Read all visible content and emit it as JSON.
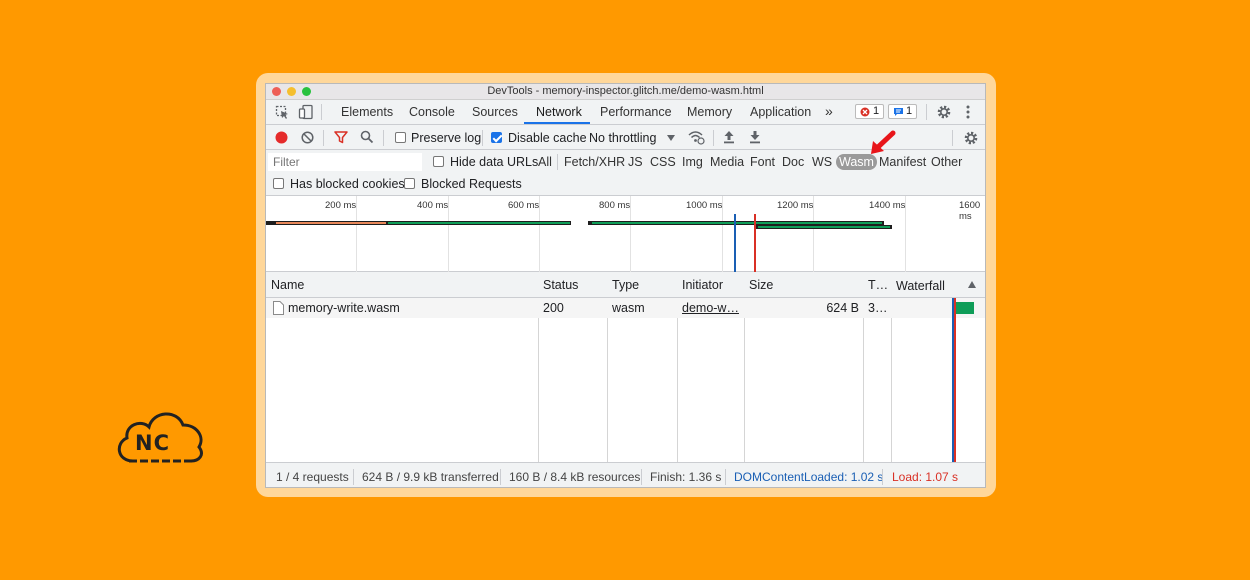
{
  "window": {
    "title": "DevTools - memory-inspector.glitch.me/demo-wasm.html"
  },
  "tabs": [
    {
      "label": "Elements"
    },
    {
      "label": "Console"
    },
    {
      "label": "Sources"
    },
    {
      "label": "Network",
      "active": true
    },
    {
      "label": "Performance"
    },
    {
      "label": "Memory"
    },
    {
      "label": "Application"
    }
  ],
  "more_tabs": "»",
  "badges": {
    "errors": "1",
    "messages": "1"
  },
  "toolbar": {
    "preserve_log": "Preserve log",
    "disable_cache": "Disable cache",
    "throttling": "No throttling"
  },
  "filter": {
    "placeholder": "Filter",
    "hide_data_urls": "Hide data URLs",
    "types": [
      "All",
      "Fetch/XHR",
      "JS",
      "CSS",
      "Img",
      "Media",
      "Font",
      "Doc",
      "WS",
      "Wasm",
      "Manifest",
      "Other"
    ],
    "selected_type": "Wasm",
    "has_blocked_cookies": "Has blocked cookies",
    "blocked_requests": "Blocked Requests"
  },
  "overview": {
    "ticks": [
      "200 ms",
      "400 ms",
      "600 ms",
      "800 ms",
      "1000 ms",
      "1200 ms",
      "1400 ms",
      "1600 ms"
    ]
  },
  "columns": {
    "name": "Name",
    "status": "Status",
    "type": "Type",
    "initiator": "Initiator",
    "size": "Size",
    "time": "T…",
    "waterfall": "Waterfall"
  },
  "rows": [
    {
      "name": "memory-write.wasm",
      "status": "200",
      "type": "wasm",
      "initiator": "demo-w…",
      "size": "624 B",
      "time": "3…"
    }
  ],
  "status": {
    "requests": "1 / 4 requests",
    "transferred": "624 B / 9.9 kB transferred",
    "resources": "160 B / 8.4 kB resources",
    "finish": "Finish: 1.36 s",
    "dom_content_loaded": "DOMContentLoaded: 1.02 s",
    "load": "Load: 1.07 s"
  },
  "colors": {
    "background": "#FF9900",
    "accent": "#1a73e8",
    "dcl_line": "#1a5fb4",
    "load_line": "#d93025",
    "annotation_arrow": "#e8151a"
  },
  "logo": {
    "text": "NC"
  }
}
